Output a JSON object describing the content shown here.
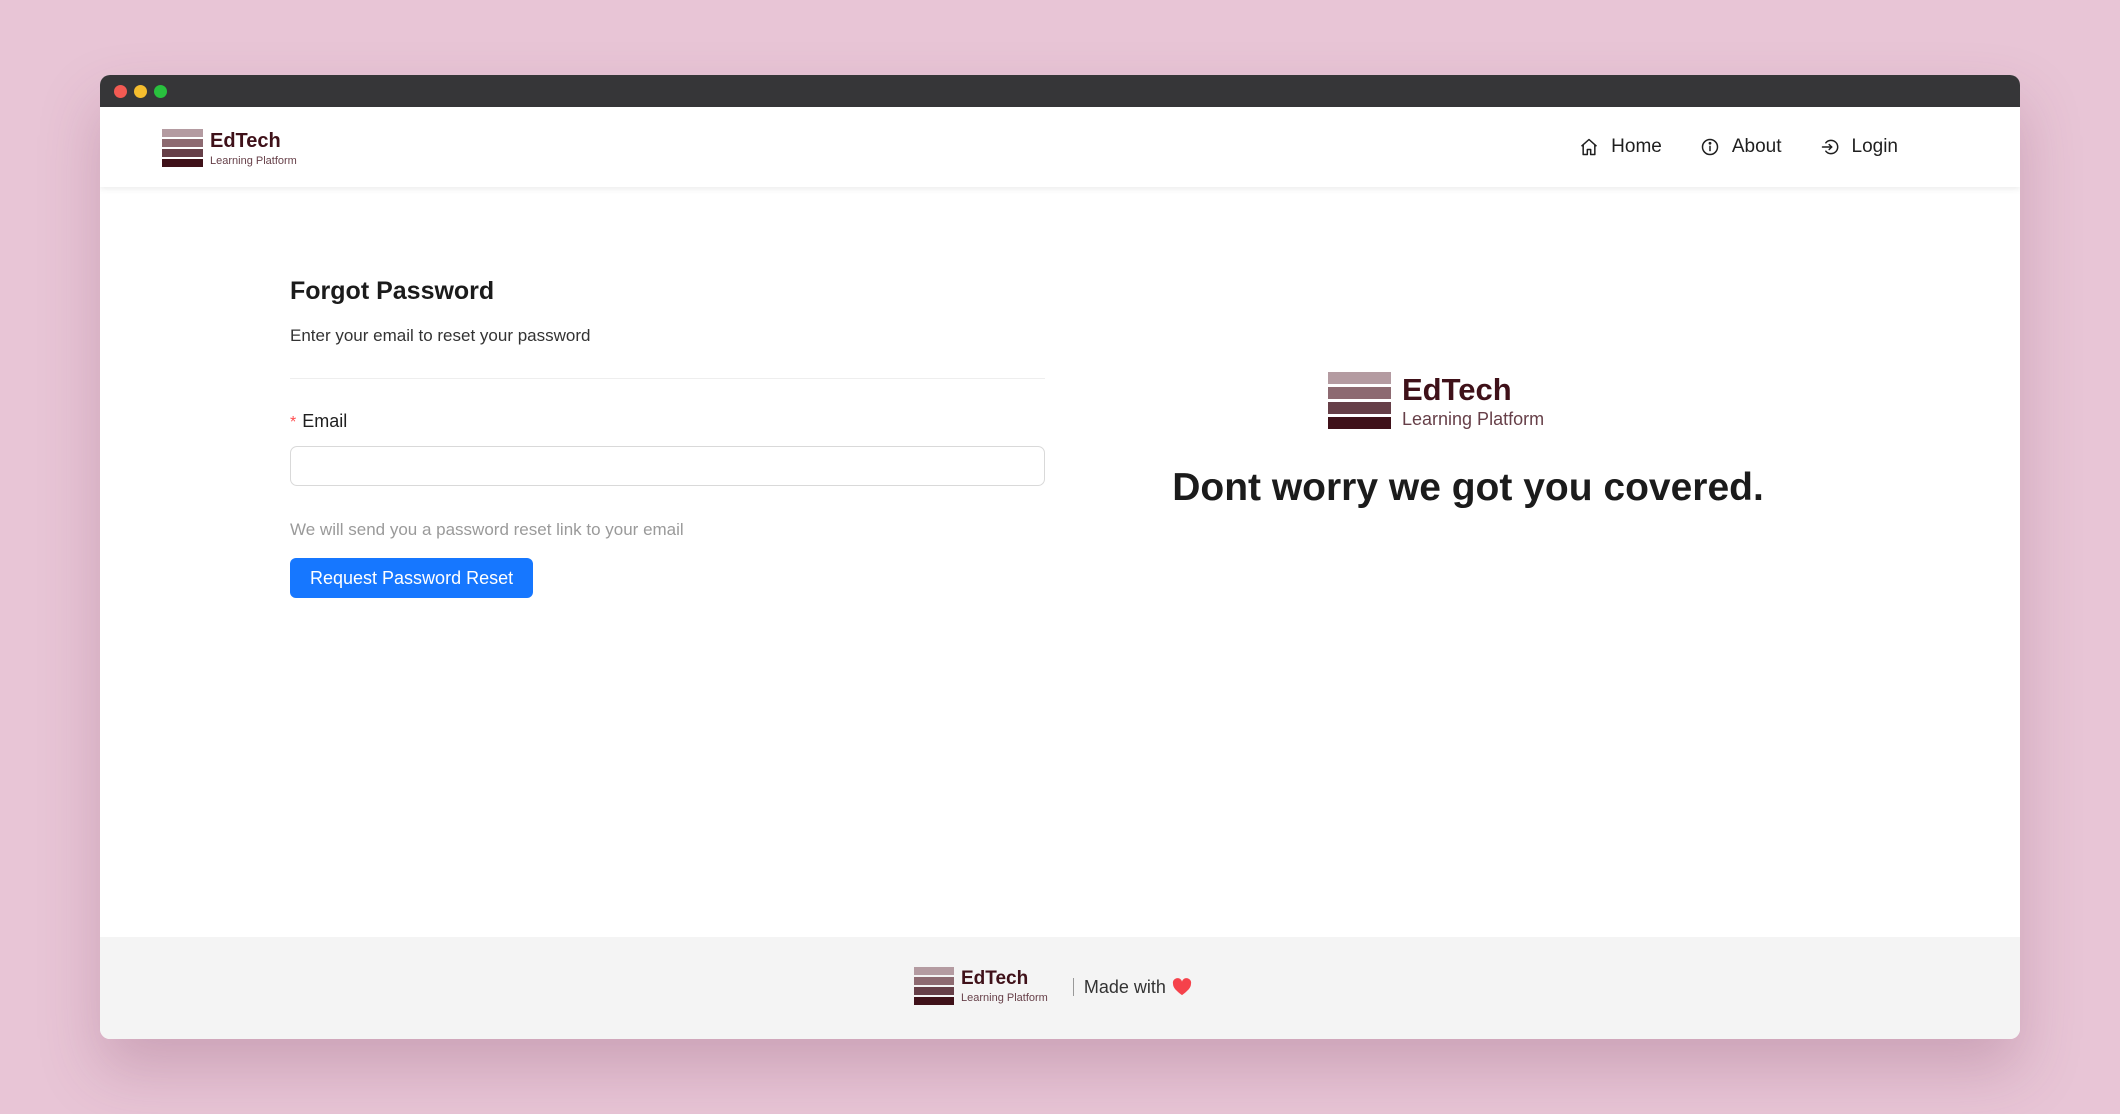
{
  "navbar": {
    "logo": {
      "brand": "EdTech",
      "tagline": "Learning Platform"
    },
    "links": [
      {
        "label": "Home",
        "icon": "home-icon"
      },
      {
        "label": "About",
        "icon": "info-icon"
      },
      {
        "label": "Login",
        "icon": "login-icon"
      }
    ]
  },
  "form": {
    "title": "Forgot Password",
    "subtitle": "Enter your email to reset your password",
    "email_label": "Email",
    "required_marker": "*",
    "email_value": "",
    "hint": "We will send you a password reset link to your email",
    "submit_label": "Request Password Reset"
  },
  "hero": {
    "logo": {
      "brand": "EdTech",
      "tagline": "Learning Platform"
    },
    "headline": "Dont worry we got you covered."
  },
  "footer": {
    "logo": {
      "brand": "EdTech",
      "tagline": "Learning Platform"
    },
    "made_with": "Made with",
    "heart_icon": "heart-icon"
  },
  "colors": {
    "background": "#e8c5d6",
    "brand_dark": "#3f1119",
    "primary_button": "#1677ff",
    "required": "#ff4d4f",
    "heart": "#f5424b"
  }
}
